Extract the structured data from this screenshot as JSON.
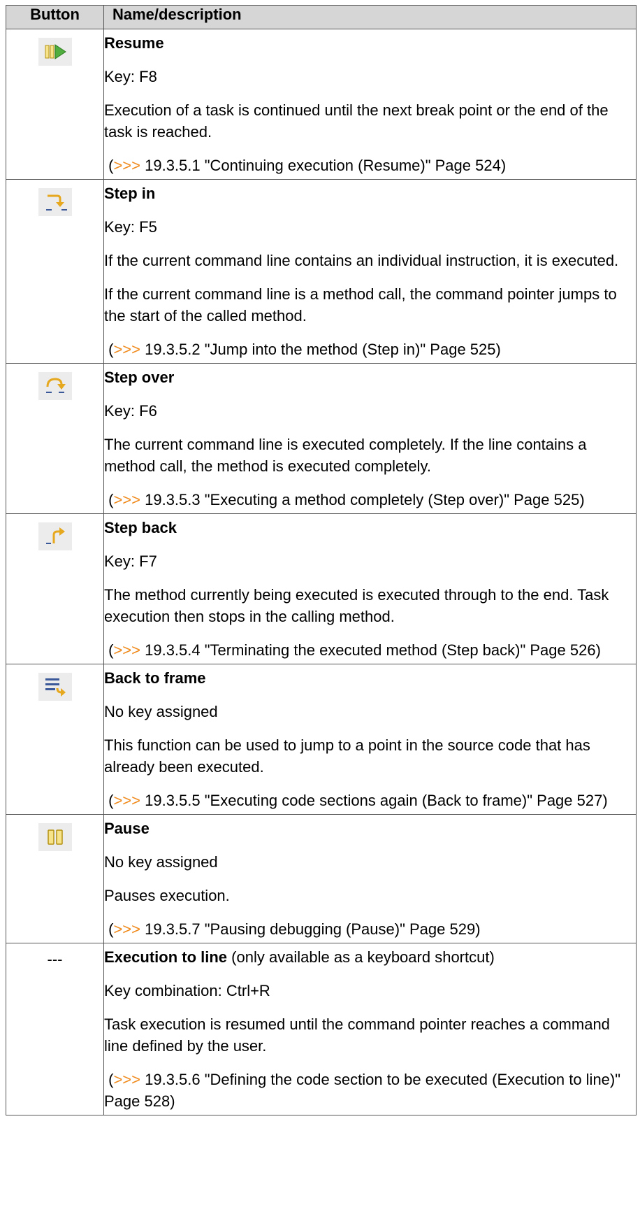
{
  "table": {
    "headers": {
      "button": "Button",
      "description": "Name/description"
    },
    "rows": [
      {
        "name": "Resume",
        "key": "Key: F8",
        "paragraphs": [
          "Execution of a task is continued until the next break point or the end of the task is reached."
        ],
        "ref_arrow": ">>>",
        "ref_text": " 19.3.5.1 \"Continuing execution (Resume)\" Page 524)",
        "icon": "resume-icon"
      },
      {
        "name": "Step in",
        "key": "Key: F5",
        "paragraphs": [
          "If the current command line contains an individual instruction, it is executed.",
          "If the current command line is a method call, the command pointer jumps to the start of the called method."
        ],
        "ref_arrow": ">>>",
        "ref_text": " 19.3.5.2 \"Jump into the method (Step in)\" Page 525)",
        "icon": "step-in-icon"
      },
      {
        "name": "Step over",
        "key": "Key: F6",
        "paragraphs": [
          "The current command line is executed completely. If the line contains a method call, the method is executed completely."
        ],
        "ref_arrow": ">>>",
        "ref_text": " 19.3.5.3 \"Executing a method completely (Step over)\" Page 525)",
        "icon": "step-over-icon"
      },
      {
        "name": "Step back",
        "key": "Key: F7",
        "paragraphs": [
          "The method currently being executed is executed through to the end. Task execution then stops in the calling method."
        ],
        "ref_arrow": ">>>",
        "ref_text": " 19.3.5.4 \"Terminating the executed method (Step back)\" Page 526)",
        "icon": "step-back-icon"
      },
      {
        "name": "Back to frame",
        "key": "No key assigned",
        "paragraphs": [
          "This function can be used to jump to a point in the source code that has already been executed."
        ],
        "ref_arrow": ">>>",
        "ref_text": " 19.3.5.5 \"Executing code sections again (Back to frame)\" Page 527)",
        "icon": "back-to-frame-icon"
      },
      {
        "name": "Pause",
        "key": "No key assigned",
        "paragraphs": [
          "Pauses execution."
        ],
        "ref_arrow": ">>>",
        "ref_text": " 19.3.5.7 \"Pausing debugging (Pause)\" Page 529)",
        "icon": "pause-icon"
      },
      {
        "button_text": "---",
        "name": "Execution to line",
        "name_note": " (only available as a keyboard shortcut)",
        "key": "Key combination: Ctrl+R",
        "paragraphs": [
          "Task execution is resumed until the command pointer reaches a command line defined by the user."
        ],
        "ref_arrow": ">>>",
        "ref_text": " 19.3.5.6 \"Defining the code section to be executed (Execution to line)\" Page 528)"
      }
    ]
  }
}
